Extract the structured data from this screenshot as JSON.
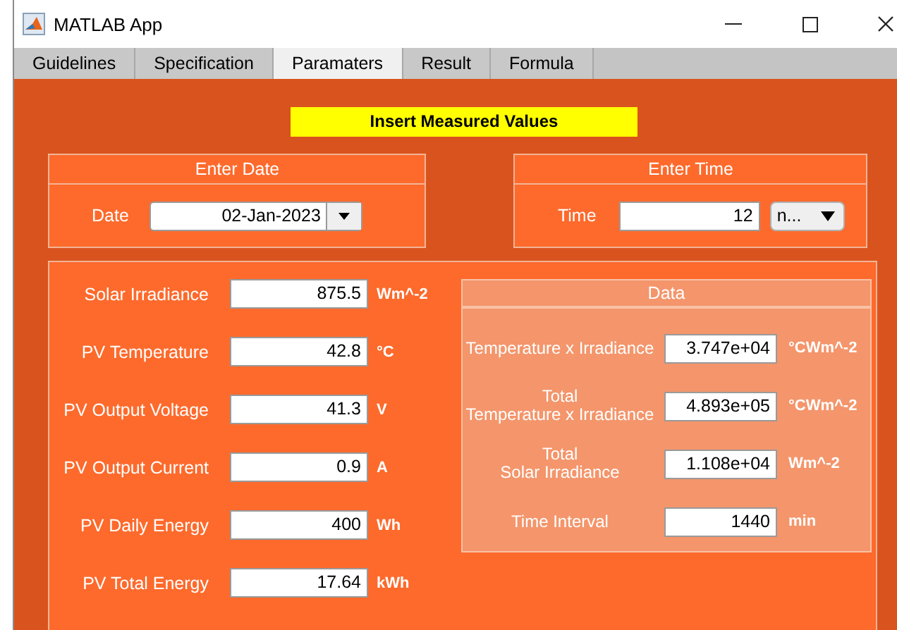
{
  "window": {
    "title": "MATLAB App"
  },
  "tabs": [
    {
      "label": "Guidelines",
      "selected": false
    },
    {
      "label": "Specification",
      "selected": false
    },
    {
      "label": "Paramaters",
      "selected": true
    },
    {
      "label": "Result",
      "selected": false
    },
    {
      "label": "Formula",
      "selected": false
    }
  ],
  "banner": "Insert Measured Values",
  "date_panel": {
    "title": "Enter Date",
    "label": "Date",
    "value": "02-Jan-2023"
  },
  "time_panel": {
    "title": "Enter Time",
    "label": "Time",
    "value": "12",
    "unit": "n..."
  },
  "measurements": [
    {
      "label": "Solar Irradiance",
      "value": "875.5",
      "unit": "Wm^-2"
    },
    {
      "label": "PV Temperature",
      "value": "42.8",
      "unit": "°C"
    },
    {
      "label": "PV Output Voltage",
      "value": "41.3",
      "unit": "V"
    },
    {
      "label": "PV Output Current",
      "value": "0.9",
      "unit": "A"
    },
    {
      "label": "PV Daily Energy",
      "value": "400",
      "unit": "Wh"
    },
    {
      "label": "PV Total Energy",
      "value": "17.64",
      "unit": "kWh"
    }
  ],
  "data_panel": {
    "title": "Data",
    "rows": [
      {
        "label": "Temperature x Irradiance",
        "value": "3.747e+04",
        "unit": "°CWm^-2"
      },
      {
        "label": "Total\nTemperature x Irradiance",
        "value": "4.893e+05",
        "unit": "°CWm^-2"
      },
      {
        "label": "Total\nSolar Irradiance",
        "value": "1.108e+04",
        "unit": "Wm^-2"
      },
      {
        "label": "Time Interval",
        "value": "1440",
        "unit": "min"
      }
    ]
  }
}
